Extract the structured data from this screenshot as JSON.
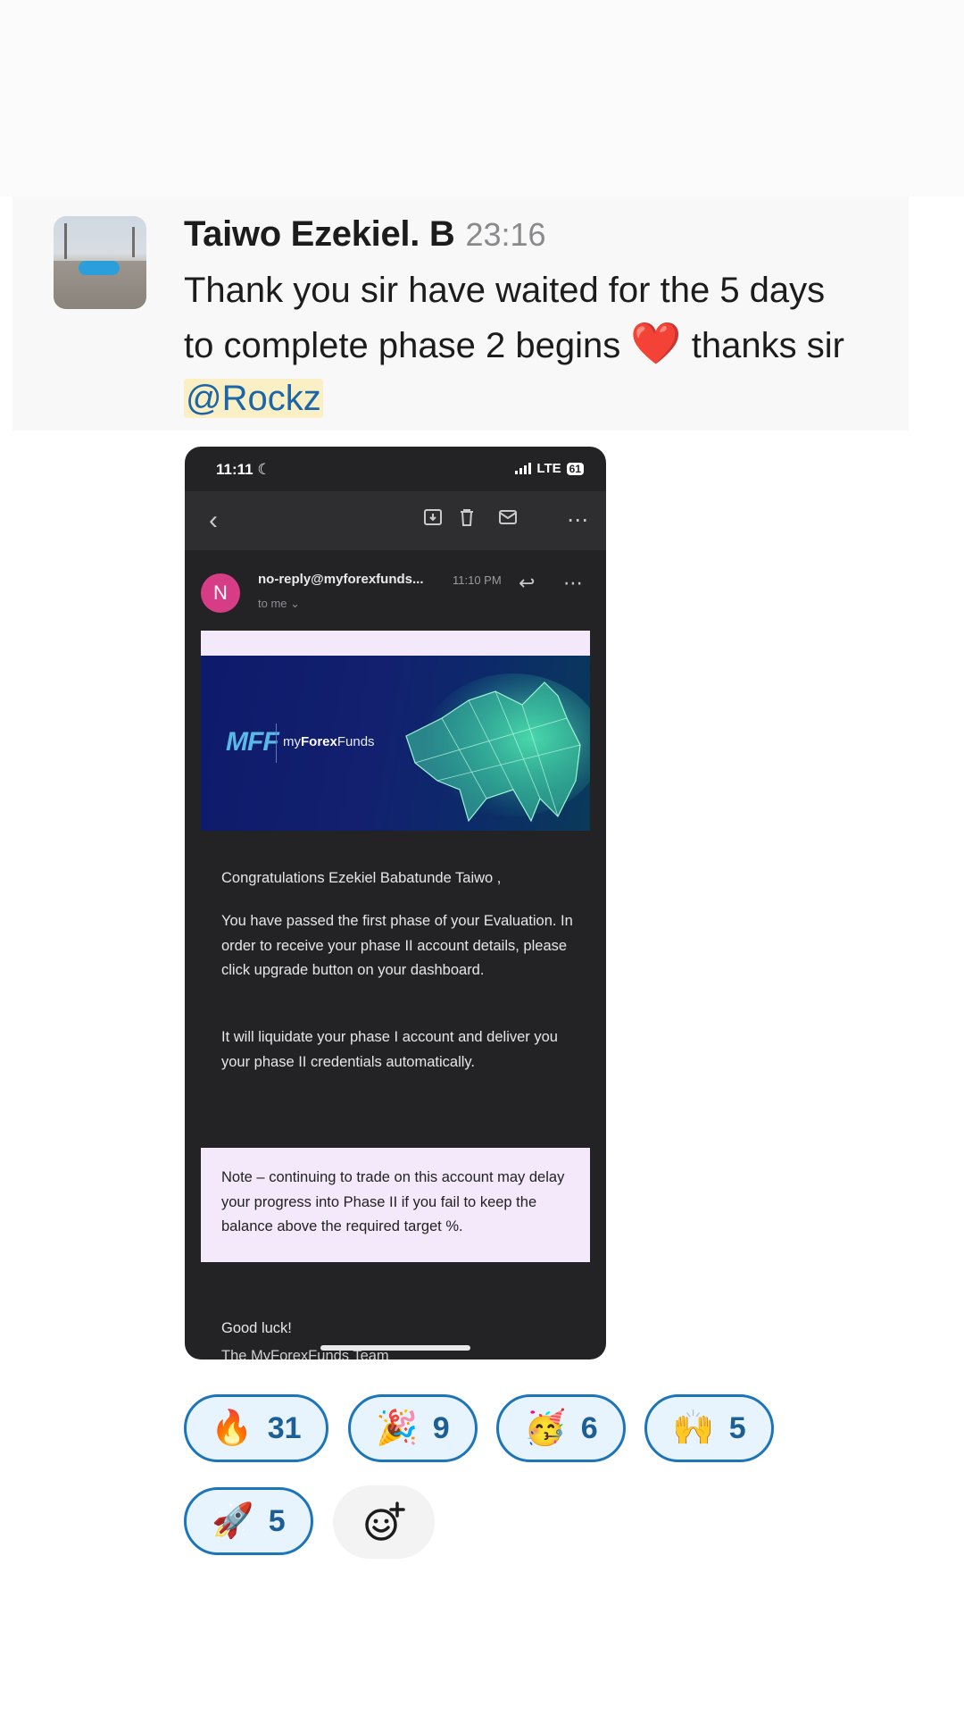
{
  "message": {
    "author": "Taiwo Ezekiel. B",
    "time": "23:16",
    "text_line1": "Thank you sir have waited for the 5 days",
    "text_line2_a": "to complete phase 2 begins",
    "heart": "❤️",
    "text_line2_b": "thanks sir",
    "mention": "@Rockz"
  },
  "attachment": {
    "status_time": "11:11",
    "network": "LTE",
    "battery": "61",
    "email": {
      "sender_initial": "N",
      "sender": "no-reply@myforexfunds...",
      "sent_time": "11:10 PM",
      "recipient": "to me",
      "banner_logo": "MFF",
      "banner_brand_prefix": "my",
      "banner_brand_bold": "Forex",
      "banner_brand_suffix": "Funds",
      "greeting": "Congratulations Ezekiel Babatunde Taiwo ,",
      "paragraph1": "You have passed the first phase of your Evaluation. In order to receive your phase II account details, please click upgrade button on your dashboard.",
      "paragraph2": "It will liquidate your phase I account and deliver you your phase II credentials automatically.",
      "note": "Note – continuing to trade on this account may delay your progress into Phase II if you fail to keep the balance above the required target %.",
      "closing": "Good luck!",
      "signoff": "The MyForexFunds Team"
    }
  },
  "reactions": [
    {
      "emoji": "🔥",
      "count": "31",
      "icon": "fire-icon"
    },
    {
      "emoji": "🎉",
      "count": "9",
      "icon": "party-popper-icon"
    },
    {
      "emoji": "🥳",
      "count": "6",
      "icon": "party-face-icon"
    },
    {
      "emoji": "🙌",
      "count": "5",
      "icon": "raised-hands-icon"
    },
    {
      "emoji": "🚀",
      "count": "5",
      "icon": "rocket-icon"
    }
  ],
  "add_reaction_icon": "add-emoji-icon",
  "colors": {
    "mention_bg": "#fbf0c5",
    "mention_text": "#1c66a8",
    "reaction_border": "#1d75b9",
    "reaction_bg": "#e8f4fd"
  }
}
